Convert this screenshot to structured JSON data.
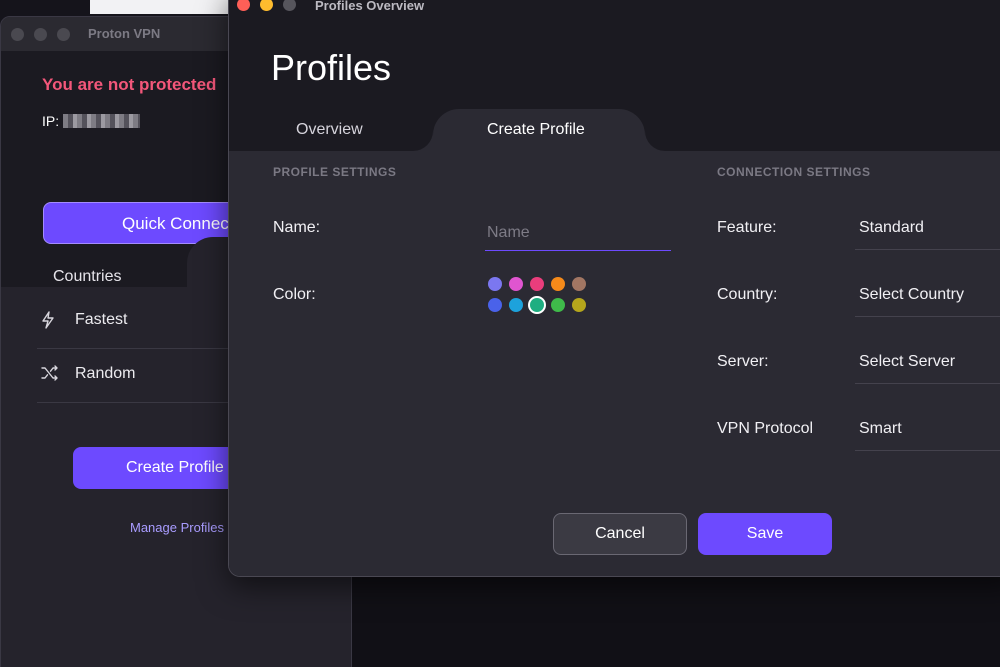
{
  "main_window": {
    "title": "Proton VPN",
    "status": "You are not protected",
    "ip_label": "IP:",
    "quick_connect_label": "Quick Connec",
    "tab_countries": "Countries",
    "items": [
      {
        "label": "Fastest",
        "icon": "lightning-icon"
      },
      {
        "label": "Random",
        "icon": "shuffle-icon"
      }
    ],
    "create_profile_label": "Create Profile",
    "manage_profiles_label": "Manage Profiles"
  },
  "profiles_window": {
    "title": "Profiles Overview",
    "heading": "Profiles",
    "tabs": [
      "Overview",
      "Create Profile"
    ],
    "active_tab": "Create Profile",
    "profile_settings_header": "PROFILE SETTINGS",
    "connection_settings_header": "CONNECTION SETTINGS",
    "name_label": "Name:",
    "name_placeholder": "Name",
    "color_label": "Color:",
    "colors": [
      "#7b77f0",
      "#e055d0",
      "#ea3d7c",
      "#f58a1a",
      "#a27663",
      "#4a62ea",
      "#1da2dc",
      "#1fae81",
      "#3fbb4a",
      "#b5a61c"
    ],
    "selected_color": "#1fae81",
    "feature_label": "Feature:",
    "feature_value": "Standard",
    "country_label": "Country:",
    "country_value": "Select Country",
    "server_label": "Server:",
    "server_value": "Select Server",
    "protocol_label": "VPN Protocol",
    "protocol_value": "Smart",
    "cancel_label": "Cancel",
    "save_label": "Save"
  },
  "accent_color": "#6d4aff",
  "warning_color": "#f3577a"
}
